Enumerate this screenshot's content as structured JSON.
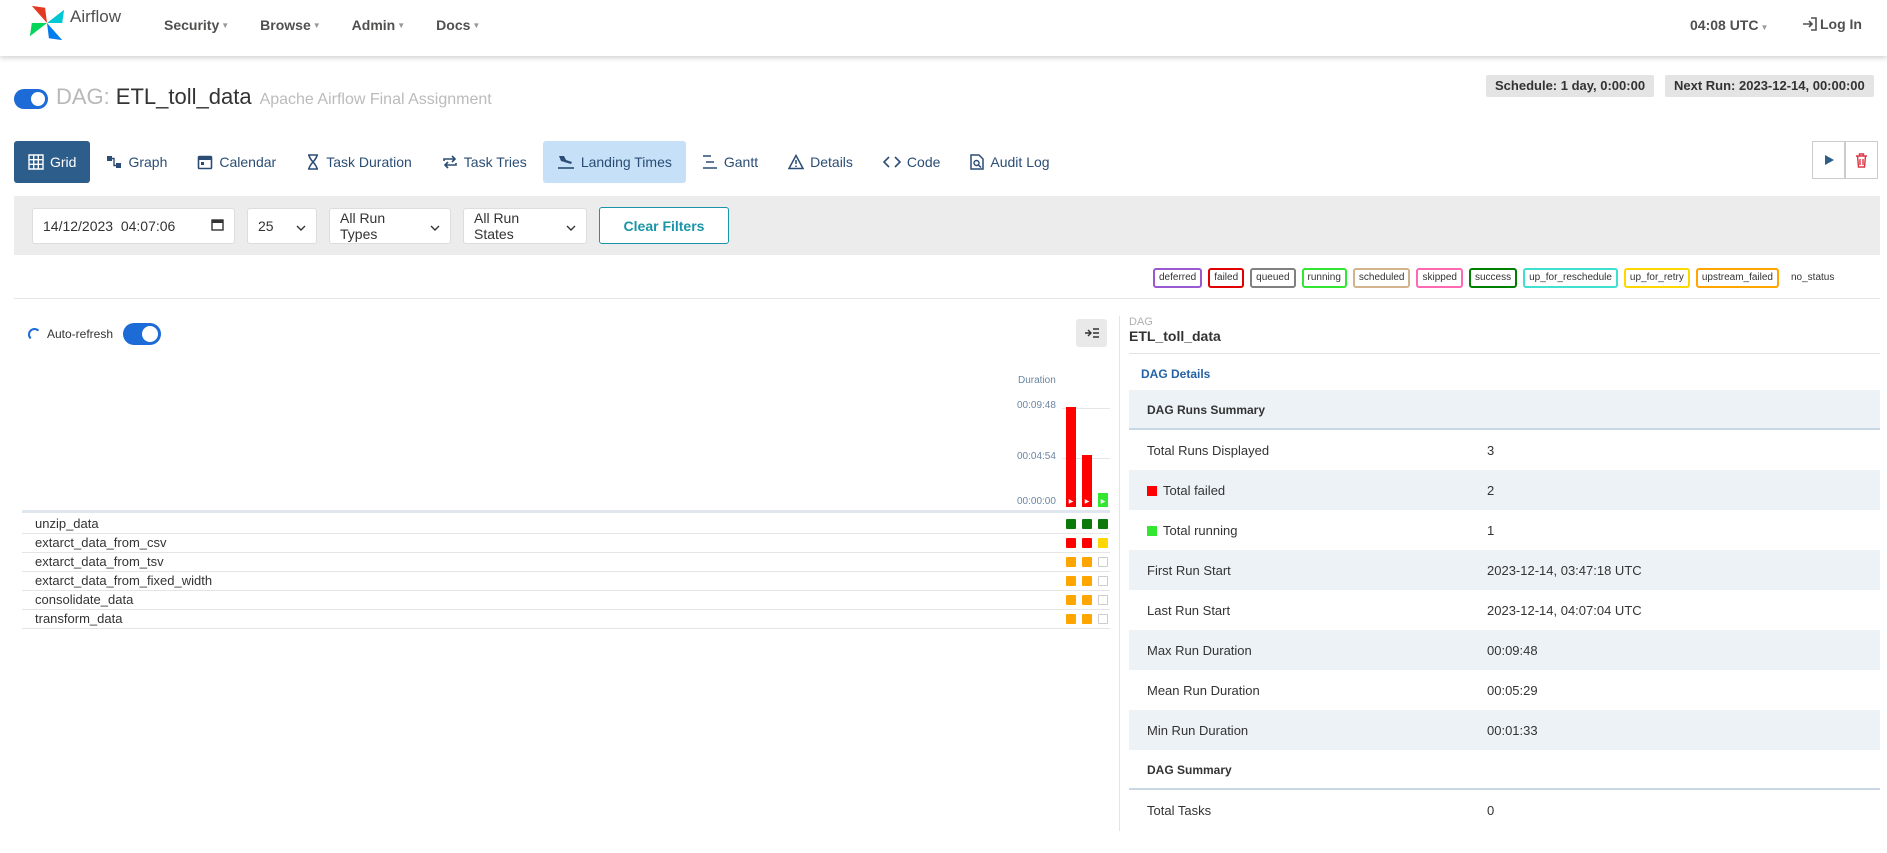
{
  "navbar": {
    "brand": "Airflow",
    "menu": [
      {
        "label": "Security"
      },
      {
        "label": "Browse"
      },
      {
        "label": "Admin"
      },
      {
        "label": "Docs"
      }
    ],
    "time": "04:08 UTC",
    "login": "Log In"
  },
  "dag": {
    "prefix": "DAG:",
    "id": "ETL_toll_data",
    "description": "Apache Airflow Final Assignment",
    "schedule": "Schedule: 1 day, 0:00:00",
    "next_run": "Next Run: 2023-12-14, 00:00:00",
    "paused": false
  },
  "tabs": [
    {
      "label": "Grid",
      "icon": "grid-icon"
    },
    {
      "label": "Graph",
      "icon": "graph-icon"
    },
    {
      "label": "Calendar",
      "icon": "calendar-icon"
    },
    {
      "label": "Task Duration",
      "icon": "hourglass-icon"
    },
    {
      "label": "Task Tries",
      "icon": "repeat-icon"
    },
    {
      "label": "Landing Times",
      "icon": "plane-landing-icon"
    },
    {
      "label": "Gantt",
      "icon": "gantt-icon"
    },
    {
      "label": "Details",
      "icon": "warning-triangle-icon"
    },
    {
      "label": "Code",
      "icon": "code-icon"
    },
    {
      "label": "Audit Log",
      "icon": "file-search-icon"
    }
  ],
  "filters": {
    "date": "14/12/2023  04:07:06",
    "num_runs": "25",
    "run_type": "All Run Types",
    "run_state": "All Run States",
    "clear": "Clear Filters"
  },
  "legend": [
    {
      "label": "deferred",
      "color": "#9b59d0"
    },
    {
      "label": "failed",
      "color": "#e00000"
    },
    {
      "label": "queued",
      "color": "#808080"
    },
    {
      "label": "running",
      "color": "#32e632"
    },
    {
      "label": "scheduled",
      "color": "#d2b48c"
    },
    {
      "label": "skipped",
      "color": "#ff69b4"
    },
    {
      "label": "success",
      "color": "#008000"
    },
    {
      "label": "up_for_reschedule",
      "color": "#40e0d0"
    },
    {
      "label": "up_for_retry",
      "color": "#ffd700"
    },
    {
      "label": "upstream_failed",
      "color": "#ffa500"
    },
    {
      "label": "no_status",
      "color": "transparent"
    }
  ],
  "grid": {
    "auto_refresh": "Auto-refresh",
    "duration_label": "Duration",
    "ticks": [
      "00:09:48",
      "00:04:54",
      "00:00:00"
    ],
    "run_fraction_of_max": [
      1.0,
      0.52,
      0.14
    ],
    "run_colors": [
      "#ff0000",
      "#ff0000",
      "#32e632"
    ],
    "tasks": [
      {
        "name": "unzip_data",
        "states": [
          "#0b7a0b",
          "#0b7a0b",
          "#0b7a0b"
        ]
      },
      {
        "name": "extarct_data_from_csv",
        "states": [
          "#ff0000",
          "#ff0000",
          "#ffd700"
        ]
      },
      {
        "name": "extarct_data_from_tsv",
        "states": [
          "#ffa500",
          "#ffa500",
          "empty"
        ]
      },
      {
        "name": "extarct_data_from_fixed_width",
        "states": [
          "#ffa500",
          "#ffa500",
          "empty"
        ]
      },
      {
        "name": "consolidate_data",
        "states": [
          "#ffa500",
          "#ffa500",
          "empty"
        ]
      },
      {
        "name": "transform_data",
        "states": [
          "#ffa500",
          "#ffa500",
          "empty"
        ]
      }
    ]
  },
  "details": {
    "small_label": "DAG",
    "title": "ETL_toll_data",
    "link": "DAG Details",
    "runs_summary_header": "DAG Runs Summary",
    "rows": [
      {
        "k": "Total Runs Displayed",
        "v": "3"
      },
      {
        "k": "Total failed",
        "v": "2",
        "dot": "#ff0000"
      },
      {
        "k": "Total running",
        "v": "1",
        "dot": "#32e632"
      },
      {
        "k": "First Run Start",
        "v": "2023-12-14, 03:47:18 UTC"
      },
      {
        "k": "Last Run Start",
        "v": "2023-12-14, 04:07:04 UTC"
      },
      {
        "k": "Max Run Duration",
        "v": "00:09:48"
      },
      {
        "k": "Mean Run Duration",
        "v": "00:05:29"
      },
      {
        "k": "Min Run Duration",
        "v": "00:01:33"
      }
    ],
    "dag_summary_header": "DAG Summary",
    "summary_rows": [
      {
        "k": "Total Tasks",
        "v": "0"
      }
    ]
  }
}
